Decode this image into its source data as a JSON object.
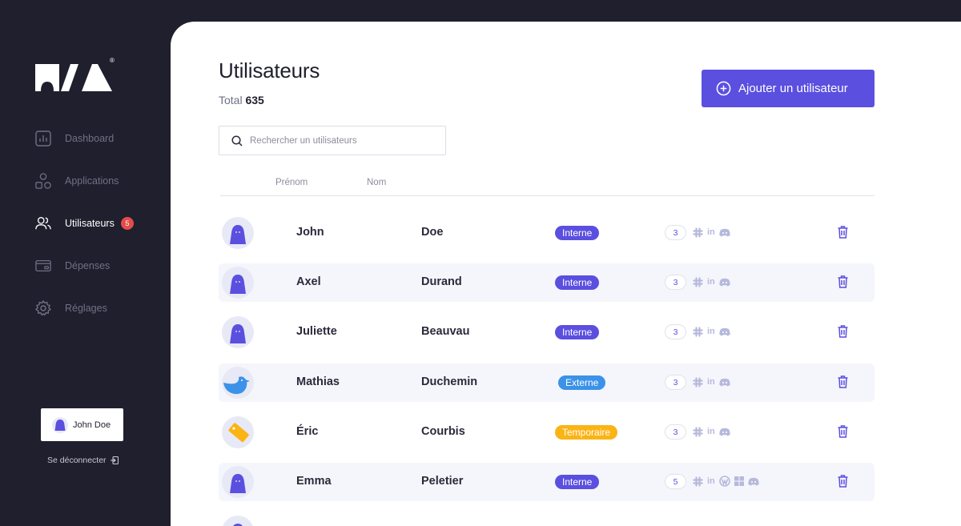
{
  "brand": {
    "registered_mark": "®"
  },
  "sidebar": {
    "items": [
      {
        "label": "Dashboard",
        "icon": "chart-icon"
      },
      {
        "label": "Applications",
        "icon": "shapes-icon"
      },
      {
        "label": "Utilisateurs",
        "icon": "users-icon",
        "badge": "5",
        "active": true
      },
      {
        "label": "Dépenses",
        "icon": "credit-card-icon"
      },
      {
        "label": "Réglages",
        "icon": "gear-icon"
      }
    ],
    "user": {
      "name": "John Doe"
    },
    "logout_label": "Se déconnecter"
  },
  "main": {
    "title": "Utilisateurs",
    "total_label": "Total",
    "total_value": "635",
    "add_button_label": "Ajouter un utilisateur",
    "search": {
      "placeholder": "Rechercher un utilisateurs",
      "value": ""
    },
    "columns": {
      "first_name": "Prénom",
      "last_name": "Nom"
    }
  },
  "users": [
    {
      "first_name": "John",
      "last_name": "Doe",
      "type": "Interne",
      "app_count": "3",
      "avatar": "ghost-purple",
      "apps": [
        "slack-icon",
        "linkedin-icon",
        "discord-icon"
      ]
    },
    {
      "first_name": "Axel",
      "last_name": "Durand",
      "type": "Interne",
      "app_count": "3",
      "avatar": "ghost-purple",
      "apps": [
        "slack-icon",
        "linkedin-icon",
        "discord-icon"
      ]
    },
    {
      "first_name": "Juliette",
      "last_name": "Beauvau",
      "type": "Interne",
      "app_count": "3",
      "avatar": "ghost-purple",
      "apps": [
        "slack-icon",
        "linkedin-icon",
        "discord-icon"
      ]
    },
    {
      "first_name": "Mathias",
      "last_name": "Duchemin",
      "type": "Externe",
      "app_count": "3",
      "avatar": "bird-blue",
      "apps": [
        "slack-icon",
        "linkedin-icon",
        "discord-icon"
      ]
    },
    {
      "first_name": "Éric",
      "last_name": "Courbis",
      "type": "Temporaire",
      "app_count": "3",
      "avatar": "tag-yellow",
      "apps": [
        "slack-icon",
        "linkedin-icon",
        "discord-icon"
      ]
    },
    {
      "first_name": "Emma",
      "last_name": "Peletier",
      "type": "Interne",
      "app_count": "5",
      "avatar": "ghost-purple",
      "apps": [
        "slack-icon",
        "linkedin-icon",
        "wordpress-icon",
        "windows-icon",
        "discord-icon"
      ]
    }
  ],
  "colors": {
    "sidebar_bg": "#1f1f2e",
    "accent": "#5b4fe0",
    "interne": "#5b4fe0",
    "externe": "#3b92e8",
    "temporaire": "#fbb415",
    "badge": "#e54b4b",
    "row_shade": "#f5f6fb"
  }
}
